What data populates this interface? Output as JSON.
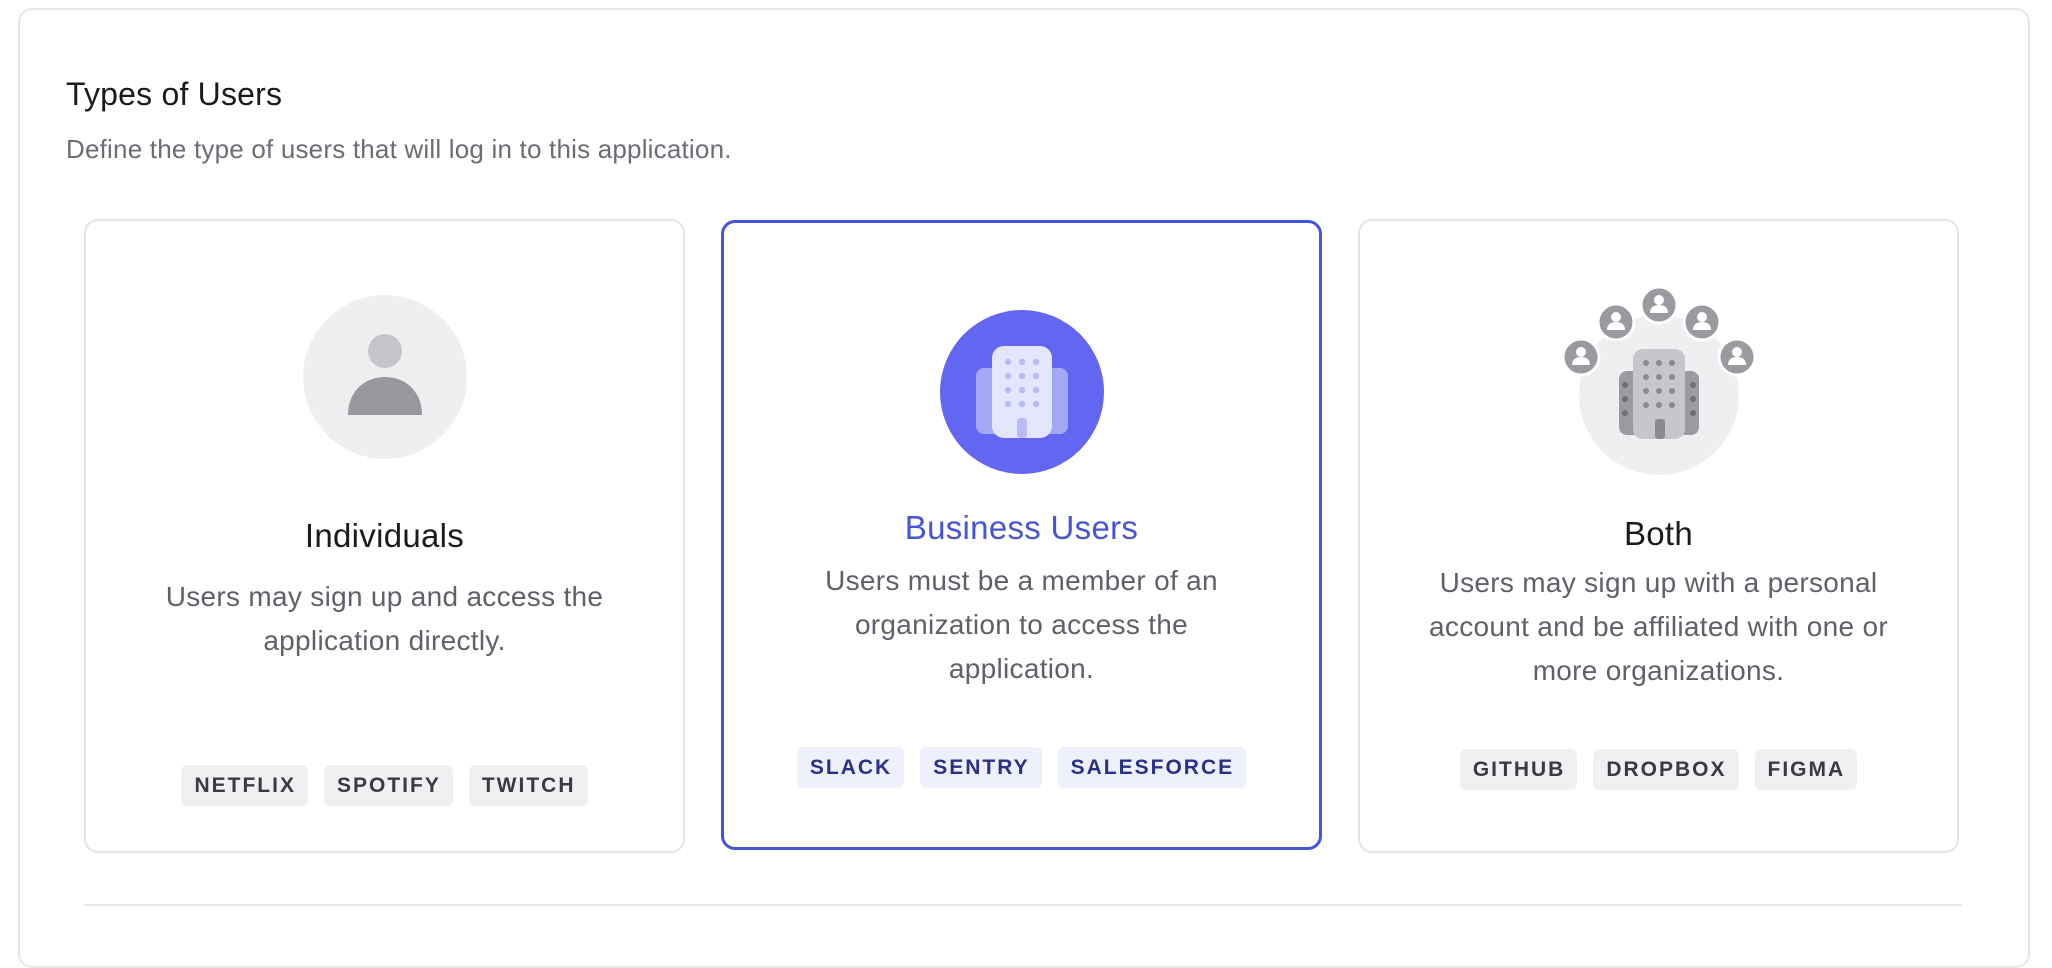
{
  "section": {
    "title": "Types of Users",
    "subtitle": "Define the type of users that will log in to this application."
  },
  "cards": [
    {
      "id": "individuals",
      "title": "Individuals",
      "description": "Users may sign up and access the application directly.",
      "tags": [
        "NETFLIX",
        "SPOTIFY",
        "TWITCH"
      ],
      "icon": "person-icon",
      "selected": false
    },
    {
      "id": "business",
      "title": "Business Users",
      "description": "Users must be a member of an organization to access the application.",
      "tags": [
        "SLACK",
        "SENTRY",
        "SALESFORCE"
      ],
      "icon": "building-icon",
      "selected": true
    },
    {
      "id": "both",
      "title": "Both",
      "description": "Users may sign up with a personal account and be affiliated with one or more organizations.",
      "tags": [
        "GITHUB",
        "DROPBOX",
        "FIGMA"
      ],
      "icon": "building-with-people-icon",
      "selected": false
    }
  ],
  "colors": {
    "accent": "#4654d8",
    "accent_fill": "#6366f1",
    "neutral_icon": "#9a9aa0",
    "neutral_bg": "#efeff1"
  }
}
